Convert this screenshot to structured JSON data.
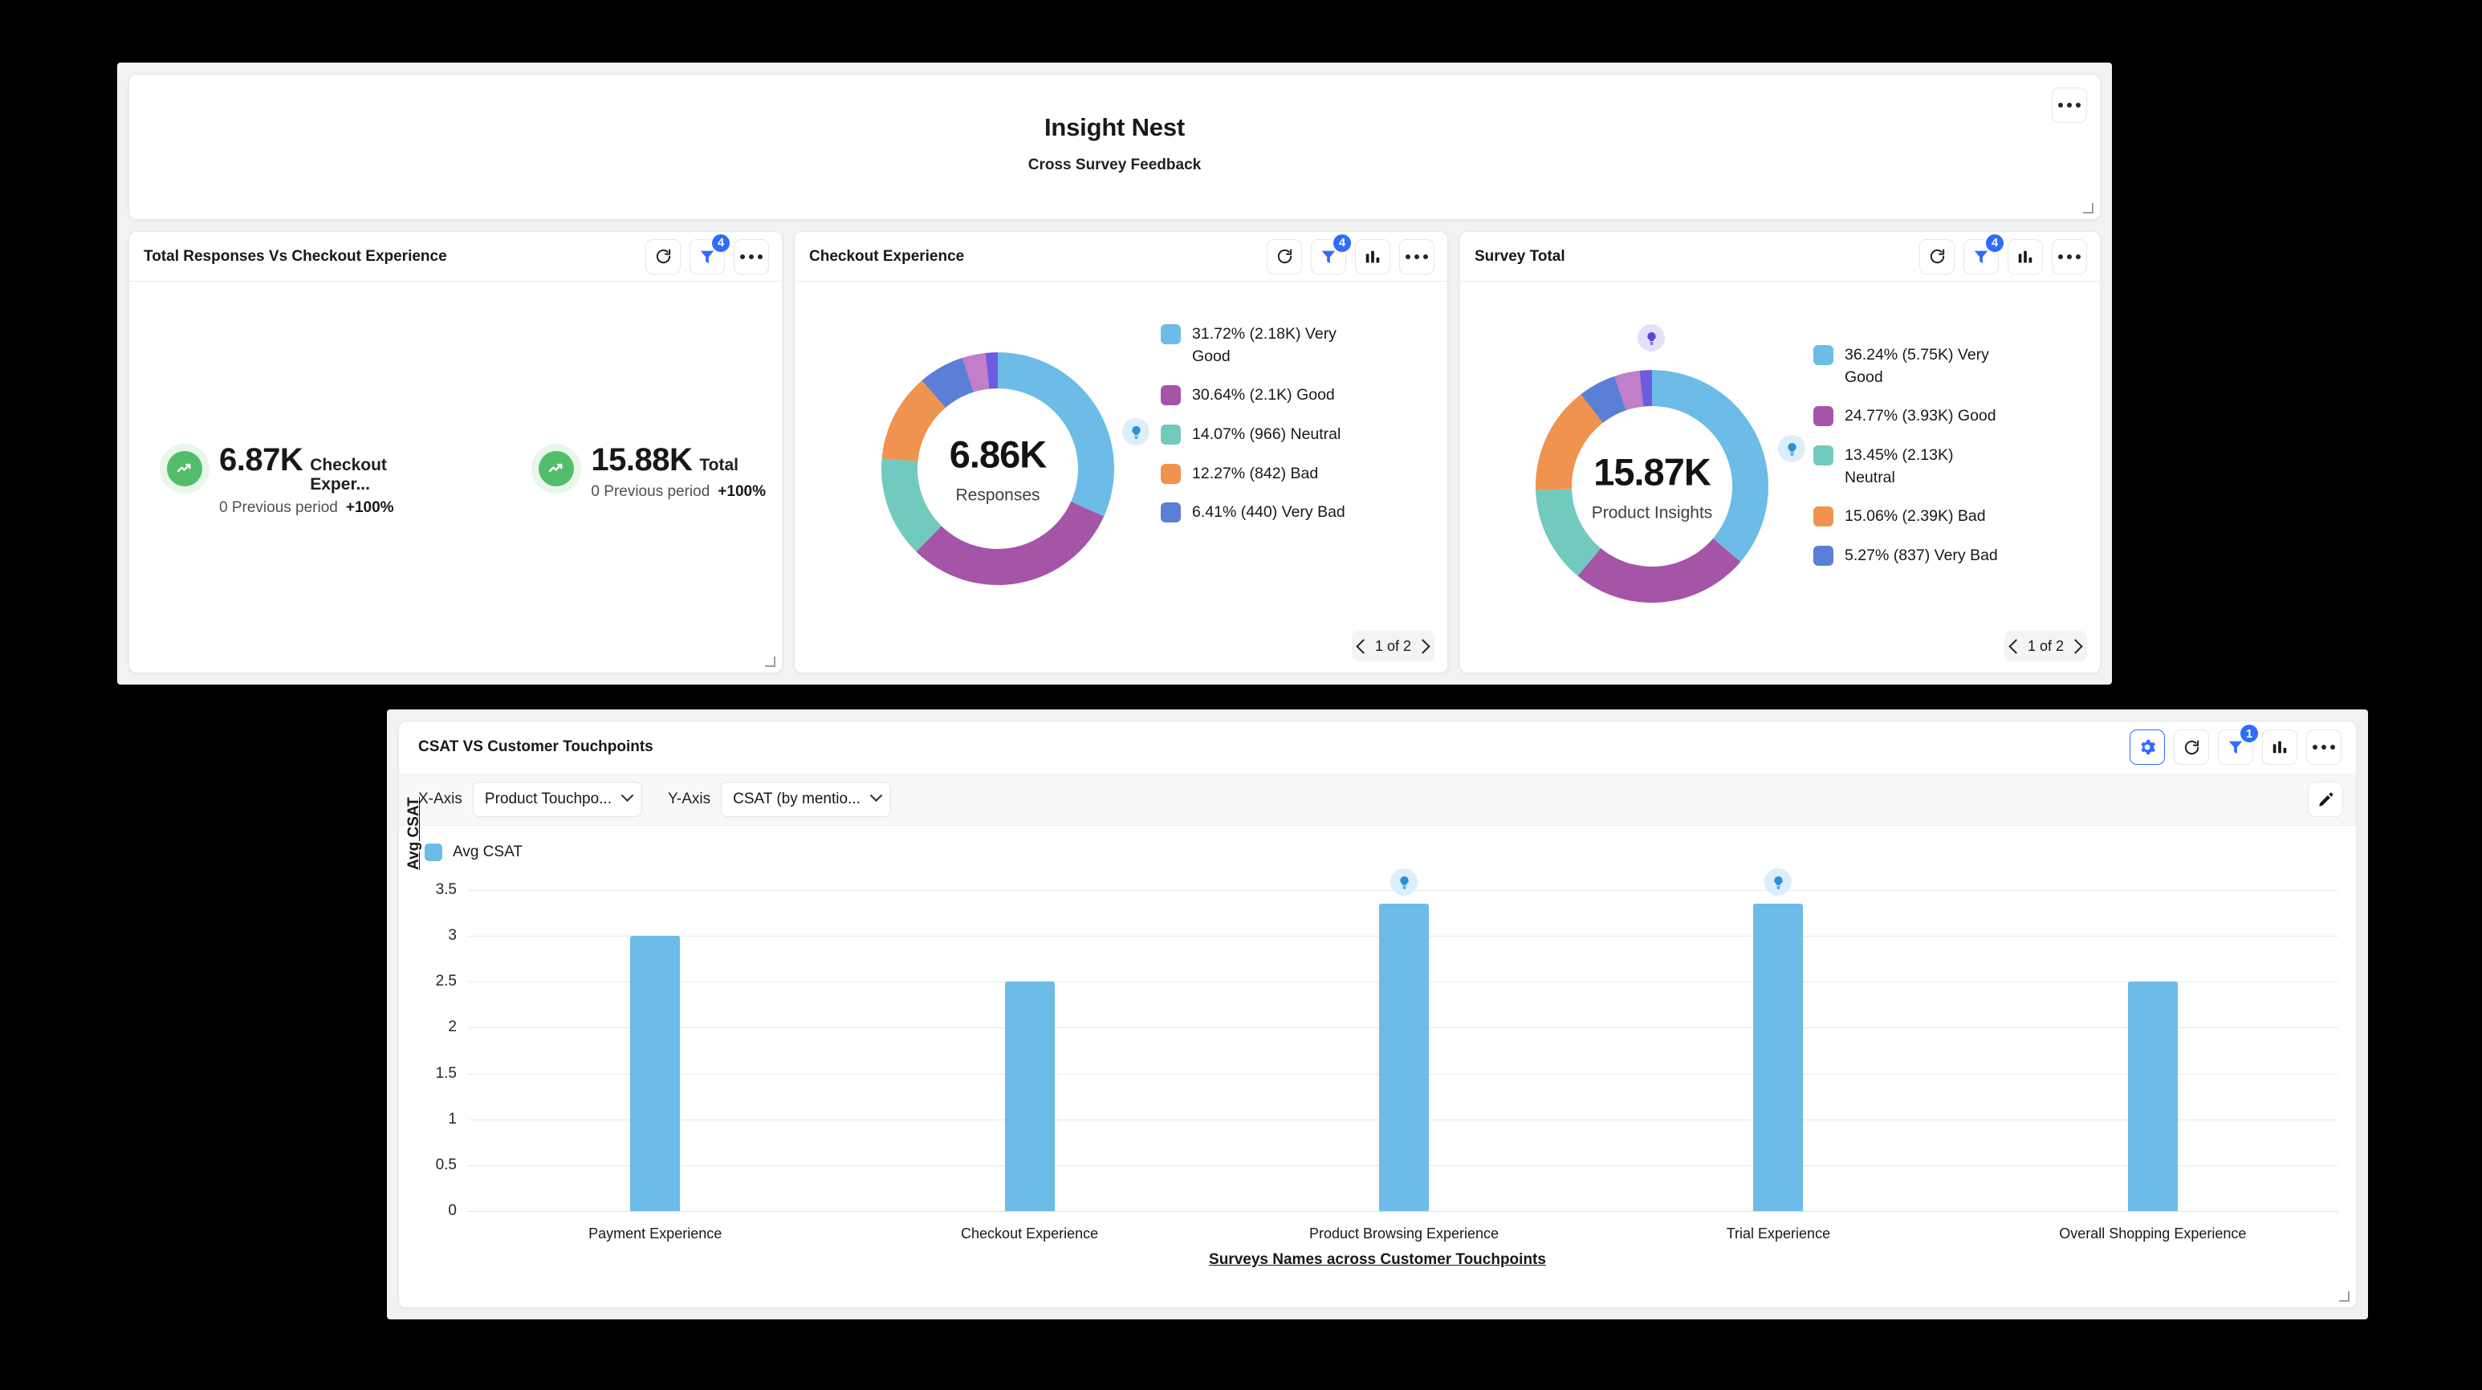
{
  "dashboard": {
    "title": "Insight Nest",
    "subtitle": "Cross Survey Feedback",
    "menu_icon": "more-options-icon"
  },
  "widgets": {
    "kpi": {
      "title": "Total Responses Vs Checkout Experience",
      "filter_badge": "4",
      "tiles": [
        {
          "value": "6.87K",
          "label": "Checkout Exper...",
          "previous": "0 Previous period",
          "delta": "+100%"
        },
        {
          "value": "15.88K",
          "label": "Total",
          "previous": "0 Previous period",
          "delta": "+100%"
        }
      ]
    },
    "checkout": {
      "title": "Checkout Experience",
      "filter_badge": "4",
      "center_value": "6.86K",
      "center_caption": "Responses",
      "pager": "1 of 2",
      "legend": [
        {
          "color": "#6cbce7",
          "text": "31.72% (2.18K)  Very Good"
        },
        {
          "color": "#a555a8",
          "text": "30.64% (2.1K)  Good"
        },
        {
          "color": "#72cabe",
          "text": "14.07% (966)  Neutral"
        },
        {
          "color": "#f0934e",
          "text": "12.27% (842)  Bad"
        },
        {
          "color": "#5b7fd4",
          "text": "6.41% (440)  Very Bad"
        }
      ]
    },
    "survey_total": {
      "title": "Survey Total",
      "filter_badge": "4",
      "center_value": "15.87K",
      "center_caption": "Product Insights",
      "pager": "1 of 2",
      "legend": [
        {
          "color": "#6cbce7",
          "text": "36.24% (5.75K)  Very Good"
        },
        {
          "color": "#a555a8",
          "text": "24.77% (3.93K)  Good"
        },
        {
          "color": "#72cabe",
          "text": "13.45% (2.13K)  Neutral"
        },
        {
          "color": "#f0934e",
          "text": "15.06% (2.39K)  Bad"
        },
        {
          "color": "#5b7fd4",
          "text": "5.27% (837)  Very Bad"
        }
      ]
    }
  },
  "bottom_panel": {
    "title": "CSAT VS Customer Touchpoints",
    "filter_badge": "1",
    "x_axis_label": "X-Axis",
    "x_axis_value": "Product Touchpo...",
    "y_axis_label": "Y-Axis",
    "y_axis_value": "CSAT (by mentio...",
    "series_name": "Avg CSAT",
    "series_color": "#6cbce7"
  },
  "chart_data": {
    "type": "bar",
    "title": "CSAT VS Customer Touchpoints",
    "xlabel": "Surveys Names across Customer Touchpoints",
    "ylabel": "Avg CSAT",
    "ylim": [
      0,
      3.5
    ],
    "yticks": [
      "0",
      "0.5",
      "1",
      "1.5",
      "2",
      "2.5",
      "3",
      "3.5"
    ],
    "grid": true,
    "legend_position": "top-left",
    "categories": [
      "Payment Experience",
      "Checkout Experience",
      "Product Browsing Experience",
      "Trial Experience",
      "Overall Shopping Experience"
    ],
    "series": [
      {
        "name": "Avg CSAT",
        "color": "#6cbce7",
        "values": [
          3.0,
          2.5,
          3.35,
          3.35,
          2.5
        ]
      }
    ],
    "insight_markers": [
      {
        "category": "Product Browsing Experience",
        "icon": "lightbulb-icon"
      },
      {
        "category": "Trial Experience",
        "icon": "lightbulb-icon"
      }
    ]
  },
  "donut_segments": {
    "checkout": [
      {
        "color": "#6cbce7",
        "pct": 31.72
      },
      {
        "color": "#a555a8",
        "pct": 30.64
      },
      {
        "color": "#72cabe",
        "pct": 14.07
      },
      {
        "color": "#f0934e",
        "pct": 12.27
      },
      {
        "color": "#5b7fd4",
        "pct": 6.41
      },
      {
        "color": "#c27ec8",
        "pct": 3.2
      },
      {
        "color": "#6c5ce0",
        "pct": 1.69
      }
    ],
    "survey_total": [
      {
        "color": "#6cbce7",
        "pct": 36.24
      },
      {
        "color": "#a555a8",
        "pct": 24.77
      },
      {
        "color": "#72cabe",
        "pct": 13.45
      },
      {
        "color": "#f0934e",
        "pct": 15.06
      },
      {
        "color": "#5b7fd4",
        "pct": 5.27
      },
      {
        "color": "#c27ec8",
        "pct": 3.5
      },
      {
        "color": "#6c5ce0",
        "pct": 1.71
      }
    ]
  }
}
